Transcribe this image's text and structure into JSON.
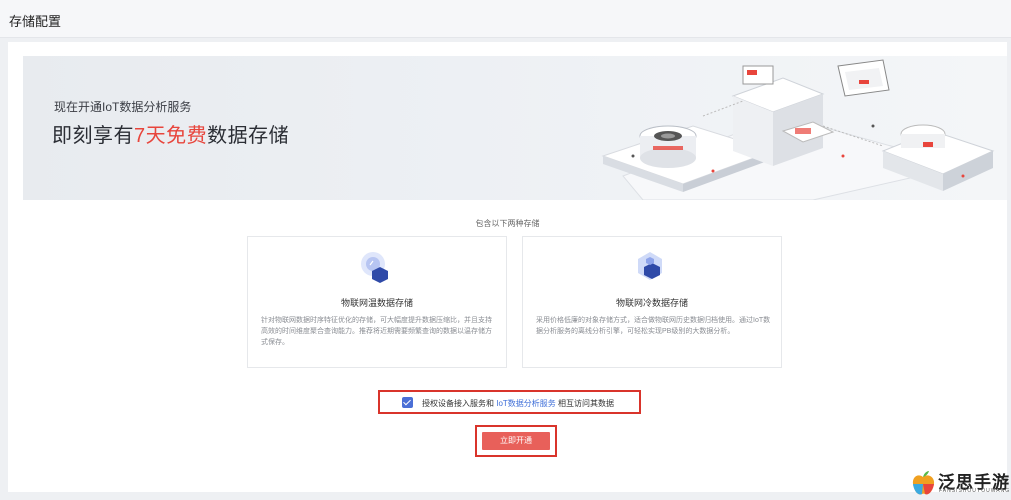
{
  "header": {
    "title": "存储配置"
  },
  "banner": {
    "subtitle": "现在开通IoT数据分析服务",
    "headline_before": "即刻享有",
    "headline_highlight": "7天免费",
    "headline_after": "数据存储"
  },
  "section": {
    "label": "包含以下两种存储"
  },
  "storage_cards": [
    {
      "name": "物联网温数据存储",
      "icon": "warm-storage-icon",
      "description": "针对物联网数据时序特征优化的存储，可大幅度提升数据压缩比，并且支持高效的时间维度聚合查询能力。推荐将近期需要频繁查询的数据以温存储方式保存。"
    },
    {
      "name": "物联网冷数据存储",
      "icon": "cold-storage-icon",
      "description": "采用价格低廉的对象存储方式，适合做物联网历史数据归档使用。通过IoT数据分析服务的离线分析引擎，可轻松实现PB级别的大数据分析。"
    }
  ],
  "agreement": {
    "checked": true,
    "text_before": "授权设备接入服务和",
    "link_text": "IoT数据分析服务",
    "text_after": "相互访问其数据"
  },
  "actions": {
    "open_label": "立即开通"
  },
  "watermark": {
    "title": "泛思手游网",
    "subtitle": "FANSISHOUYOUWANG"
  },
  "colors": {
    "accent_red": "#e8453c",
    "button": "#e8605a",
    "link": "#3f6fd8",
    "checkbox": "#4a6fd6"
  }
}
